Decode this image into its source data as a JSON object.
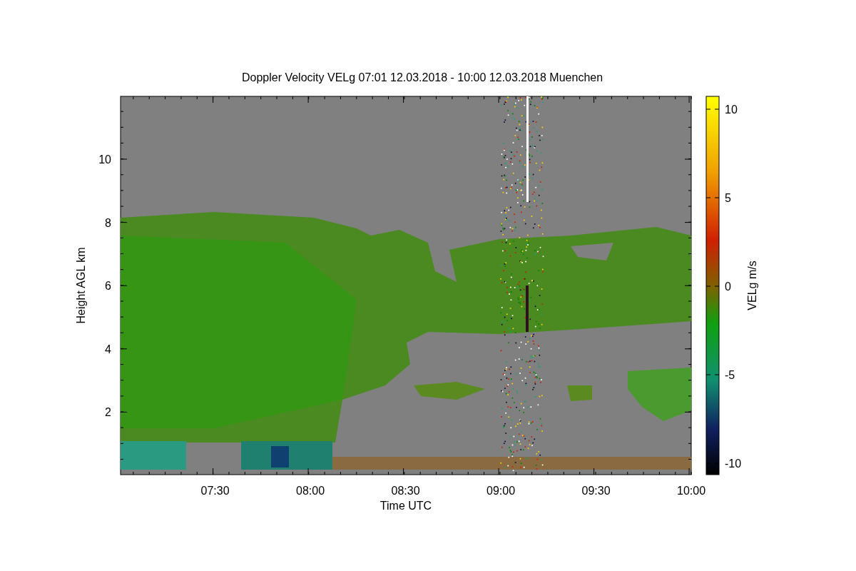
{
  "title": "Doppler Velocity VELg   07:01 12.03.2018 - 10:00 12.03.2018 Muenchen",
  "x_axis": {
    "label": "Time UTC",
    "ticks": [
      "07:30",
      "08:00",
      "08:30",
      "09:00",
      "09:30",
      "10:00"
    ]
  },
  "y_axis": {
    "label": "Height AGL km",
    "ticks": [
      "10",
      "8",
      "6",
      "4",
      "2"
    ]
  },
  "colorbar": {
    "label": "VELg m/s",
    "ticks": [
      "10",
      "5",
      "0",
      "-5",
      "-10"
    ]
  }
}
